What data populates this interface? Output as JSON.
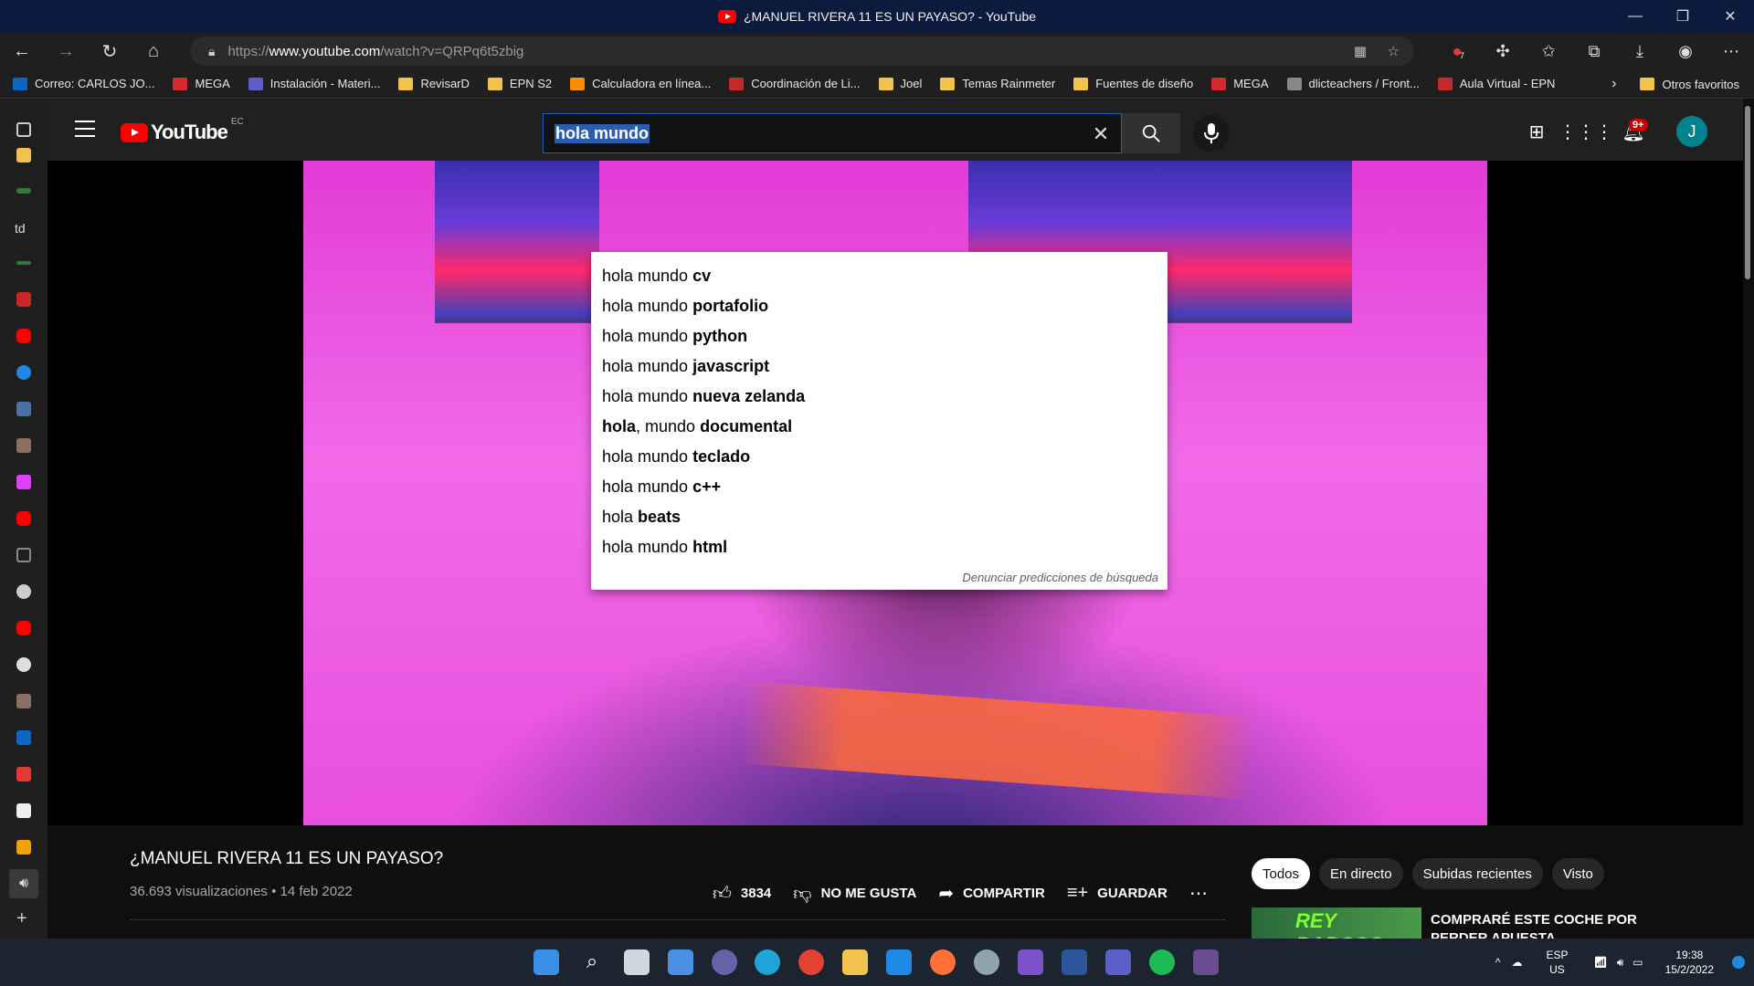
{
  "window": {
    "title": "¿MANUEL RIVERA 11 ES UN PAYASO? - YouTube",
    "controls": [
      "—",
      "❐",
      "✕"
    ]
  },
  "browser": {
    "url_prefix": "https://",
    "url_domain": "www.youtube.com",
    "url_path": "/watch?v=QRPq6t5zbig",
    "extension_badge": "7"
  },
  "bookmarks": [
    {
      "label": "Correo: CARLOS JO...",
      "color": "#0a66c2"
    },
    {
      "label": "MEGA",
      "color": "#d9272e"
    },
    {
      "label": "Instalación - Materi...",
      "color": "#5b5fc7"
    },
    {
      "label": "RevisarD",
      "color": "#f2c14e"
    },
    {
      "label": "EPN S2",
      "color": "#f2c14e"
    },
    {
      "label": "Calculadora en línea...",
      "color": "#ff8c00"
    },
    {
      "label": "Coordinación de Li...",
      "color": "#c62828"
    },
    {
      "label": "Joel",
      "color": "#f2c14e"
    },
    {
      "label": "Temas Rainmeter",
      "color": "#f2c14e"
    },
    {
      "label": "Fuentes de diseño",
      "color": "#f2c14e"
    },
    {
      "label": "MEGA",
      "color": "#d9272e"
    },
    {
      "label": "dlicteachers / Front...",
      "color": "#888888"
    },
    {
      "label": "Aula Virtual - EPN",
      "color": "#c62828"
    }
  ],
  "bookmarks_other": "Otros favoritos",
  "youtube": {
    "logo_word": "YouTube",
    "country": "EC",
    "search_value": "hola mundo",
    "notifications": "9+",
    "avatar_letter": "J",
    "suggestions": [
      {
        "pre": "hola mundo ",
        "bold": "cv"
      },
      {
        "pre": "hola mundo ",
        "bold": "portafolio"
      },
      {
        "pre": "hola mundo ",
        "bold": "python"
      },
      {
        "pre": "hola mundo ",
        "bold": "javascript"
      },
      {
        "pre": "hola mundo ",
        "bold": "nueva zelanda"
      },
      {
        "lead_bold": "hola",
        "pre": ", mundo ",
        "bold": "documental"
      },
      {
        "pre": "hola mundo ",
        "bold": "teclado"
      },
      {
        "pre": "hola mundo ",
        "bold": "c++"
      },
      {
        "pre": "hola ",
        "bold": "beats"
      },
      {
        "pre": "hola mundo ",
        "bold": "html"
      }
    ],
    "report_link": "Denunciar predicciones de búsqueda",
    "video": {
      "title": "¿MANUEL RIVERA 11 ES UN PAYASO?",
      "views": "36.693 visualizaciones",
      "date": "14 feb 2022",
      "likes": "3834",
      "dislike_label": "NO ME GUSTA",
      "share_label": "COMPARTIR",
      "save_label": "GUARDAR"
    },
    "chips": [
      "Todos",
      "En directo",
      "Subidas recientes",
      "Visto"
    ],
    "recommended": {
      "thumb_text": "REY BABOSO",
      "title": "COMPRARÉ ESTE COCHE POR PERDER APUESTA"
    }
  },
  "taskbar": {
    "lang_top": "ESP",
    "lang_bottom": "US",
    "time": "19:38",
    "date": "15/2/2022"
  }
}
